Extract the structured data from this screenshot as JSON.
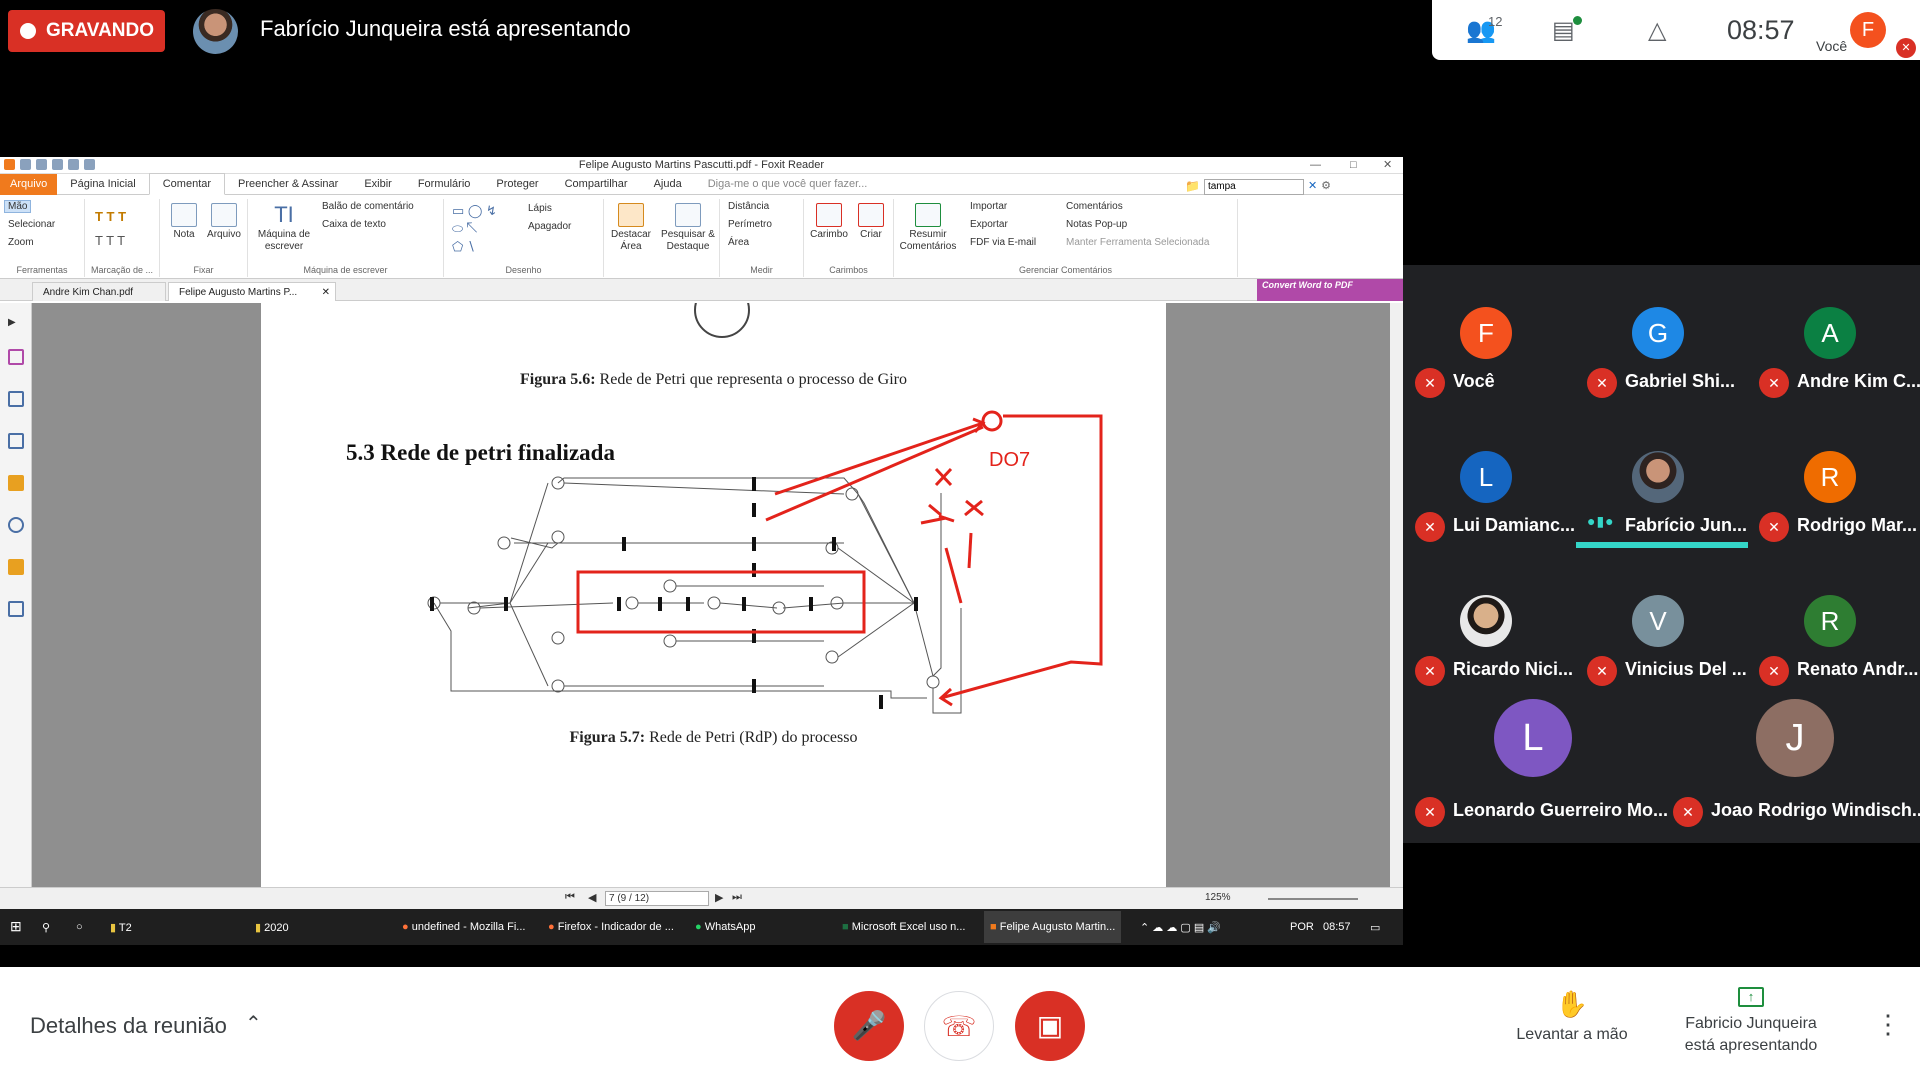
{
  "meet": {
    "recording_label": "GRAVANDO",
    "presenter_title": "Fabrício Junqueira está apresentando",
    "participants_count": "12",
    "time": "08:57",
    "self_initial": "F",
    "self_label": "Você"
  },
  "foxit": {
    "window_title": "Felipe Augusto Martins Pascutti.pdf - Foxit Reader",
    "menu": [
      "Arquivo",
      "Página Inicial",
      "Comentar",
      "Preencher & Assinar",
      "Exibir",
      "Formulário",
      "Proteger",
      "Compartilhar",
      "Ajuda"
    ],
    "active_menu": "Comentar",
    "tell_me": "Diga-me o que você quer fazer...",
    "search_value": "tampa",
    "ribbon": {
      "tools": [
        "Mão",
        "Selecionar",
        "Zoom"
      ],
      "tools_label": "Ferramentas",
      "marking_label": "Marcação de ...",
      "note": "Nota",
      "file": "Arquivo",
      "fix_label": "Fixar",
      "typewriter": "Máquina de escrever",
      "callout": "Balão de comentário",
      "textbox": "Caixa de texto",
      "typewriter_label": "Máquina de escrever",
      "pencil": "Lápis",
      "eraser": "Apagador",
      "drawing_label": "Desenho",
      "highlight_area": "Destacar Área",
      "search_highlight": "Pesquisar & Destaque",
      "distance": "Distância",
      "perimeter": "Perímetro",
      "area": "Área",
      "measure_label": "Medir",
      "stamp": "Carimbo",
      "create": "Criar",
      "stamps_label": "Carimbos",
      "summarize": "Resumir Comentários",
      "import": "Importar",
      "export": "Exportar",
      "fdf_email": "FDF via E-mail",
      "comments": "Comentários",
      "popup_notes": "Notas Pop-up",
      "keep_tool": "Manter Ferramenta Selecionada",
      "manage_label": "Gerenciar Comentários"
    },
    "tabs": [
      "Andre Kim Chan.pdf",
      "Felipe Augusto Martins P..."
    ],
    "convert_label": "Convert Word to PDF",
    "page": {
      "fig56": "Figura 5.6: Rede de Petri que representa o processo de Giro",
      "fig56_bold": "Figura 5.6:",
      "fig56_text": "Rede de Petri que representa o processo de Giro",
      "section": "5.3  Rede de petri finalizada",
      "annotation": "DO7",
      "fig57_bold": "Figura 5.7:",
      "fig57_text": "Rede de Petri (RdP) do processo"
    },
    "page_indicator": "7 (9 / 12)",
    "zoom": "125%"
  },
  "taskbar": {
    "items": [
      "T2",
      "2020",
      "undefined - Mozilla Fi...",
      "Firefox - Indicador de ...",
      "WhatsApp",
      "Microsoft Excel uso n...",
      "Felipe Augusto Martin..."
    ],
    "lang": "POR",
    "time": "08:57"
  },
  "participants": [
    {
      "initial": "F",
      "name": "Você",
      "color": "#f4511e"
    },
    {
      "initial": "G",
      "name": "Gabriel Shi...",
      "color": "#1e88e5"
    },
    {
      "initial": "A",
      "name": "Andre Kim C...",
      "color": "#0b8043"
    },
    {
      "initial": "L",
      "name": "Lui Damianc...",
      "color": "#1565c0"
    },
    {
      "initial": "",
      "name": "Fabrício Jun...",
      "color": "#5a4a3f"
    },
    {
      "initial": "R",
      "name": "Rodrigo Mar...",
      "color": "#ef6c00"
    },
    {
      "initial": "",
      "name": "Ricardo Nici...",
      "color": "#7a6a60"
    },
    {
      "initial": "V",
      "name": "Vinicius Del ...",
      "color": "#78909c"
    },
    {
      "initial": "R",
      "name": "Renato Andr...",
      "color": "#2e7d32"
    },
    {
      "initial": "L",
      "name": "Leonardo Guerreiro Mo...",
      "color": "#7e57c2"
    },
    {
      "initial": "J",
      "name": "Joao Rodrigo Windisch...",
      "color": "#8d6e63"
    }
  ],
  "bottom": {
    "details": "Detalhes da reunião",
    "raise_hand": "Levantar a mão",
    "presenting": "Fabricio Junqueira está apresentando"
  }
}
